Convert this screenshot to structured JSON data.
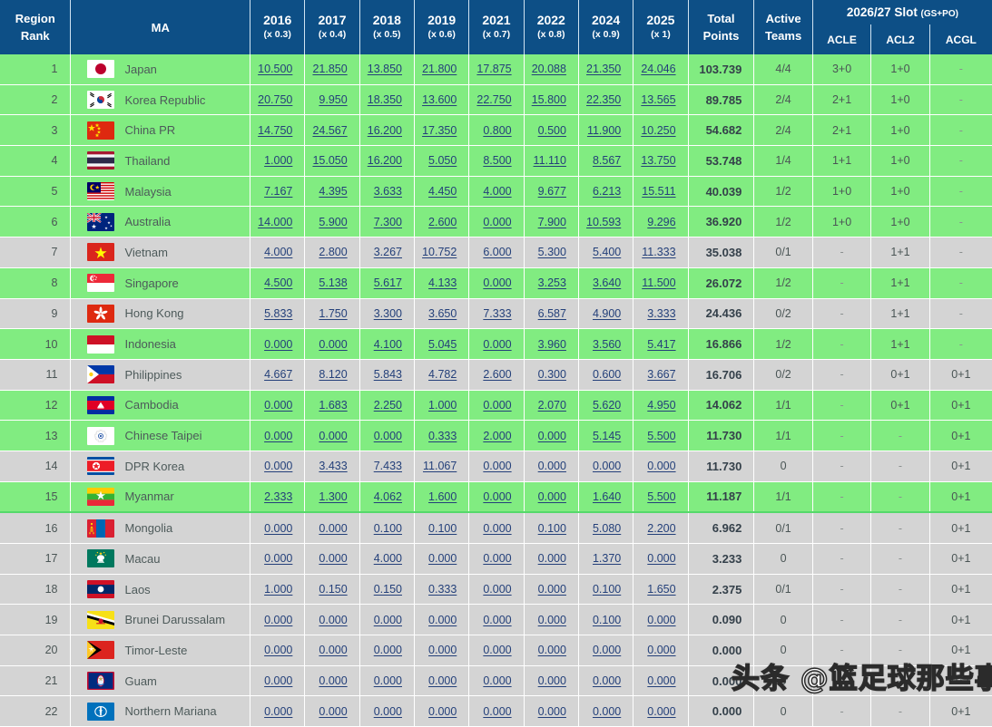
{
  "header": {
    "region_rank": "Region\nRank",
    "region_rank_l1": "Region",
    "region_rank_l2": "Rank",
    "ma": "MA",
    "years": [
      {
        "year": "2016",
        "mult": "(x 0.3)"
      },
      {
        "year": "2017",
        "mult": "(x 0.4)"
      },
      {
        "year": "2018",
        "mult": "(x 0.5)"
      },
      {
        "year": "2019",
        "mult": "(x 0.6)"
      },
      {
        "year": "2021",
        "mult": "(x 0.7)"
      },
      {
        "year": "2022",
        "mult": "(x 0.8)"
      },
      {
        "year": "2024",
        "mult": "(x 0.9)"
      },
      {
        "year": "2025",
        "mult": "(x 1)"
      }
    ],
    "total_points_l1": "Total",
    "total_points_l2": "Points",
    "active_teams_l1": "Active",
    "active_teams_l2": "Teams",
    "slot_group_title": "2026/27 Slot",
    "slot_group_sub": "(GS+PO)",
    "slot_cols": [
      "ACLE",
      "ACL2",
      "ACGL"
    ]
  },
  "colors": {
    "header_blue": "#0d4f86",
    "row_green": "#81ec81",
    "row_grey": "#d4d4d4",
    "number_blue": "#24407a",
    "separator_green": "#55d96a"
  },
  "watermark": "头条 @篮足球那些事",
  "rows": [
    {
      "rank": "1",
      "ma": "Japan",
      "flag": "japan",
      "shade": "green",
      "sep": false,
      "years": [
        "10.500",
        "21.850",
        "13.850",
        "21.800",
        "17.875",
        "20.088",
        "21.350",
        "24.046"
      ],
      "total": "103.739",
      "active": "4/4",
      "acle": "3+0",
      "acl2": "1+0",
      "acgl": "-"
    },
    {
      "rank": "2",
      "ma": "Korea Republic",
      "flag": "korea",
      "shade": "green",
      "sep": false,
      "years": [
        "20.750",
        "9.950",
        "18.350",
        "13.600",
        "22.750",
        "15.800",
        "22.350",
        "13.565"
      ],
      "total": "89.785",
      "active": "2/4",
      "acle": "2+1",
      "acl2": "1+0",
      "acgl": "-"
    },
    {
      "rank": "3",
      "ma": "China PR",
      "flag": "china",
      "shade": "green",
      "sep": false,
      "years": [
        "14.750",
        "24.567",
        "16.200",
        "17.350",
        "0.800",
        "0.500",
        "11.900",
        "10.250"
      ],
      "total": "54.682",
      "active": "2/4",
      "acle": "2+1",
      "acl2": "1+0",
      "acgl": "-"
    },
    {
      "rank": "4",
      "ma": "Thailand",
      "flag": "thailand",
      "shade": "green",
      "sep": false,
      "years": [
        "1.000",
        "15.050",
        "16.200",
        "5.050",
        "8.500",
        "11.110",
        "8.567",
        "13.750"
      ],
      "total": "53.748",
      "active": "1/4",
      "acle": "1+1",
      "acl2": "1+0",
      "acgl": "-"
    },
    {
      "rank": "5",
      "ma": "Malaysia",
      "flag": "malaysia",
      "shade": "green",
      "sep": false,
      "years": [
        "7.167",
        "4.395",
        "3.633",
        "4.450",
        "4.000",
        "9.677",
        "6.213",
        "15.511"
      ],
      "total": "40.039",
      "active": "1/2",
      "acle": "1+0",
      "acl2": "1+0",
      "acgl": "-"
    },
    {
      "rank": "6",
      "ma": "Australia",
      "flag": "australia",
      "shade": "green",
      "sep": false,
      "years": [
        "14.000",
        "5.900",
        "7.300",
        "2.600",
        "0.000",
        "7.900",
        "10.593",
        "9.296"
      ],
      "total": "36.920",
      "active": "1/2",
      "acle": "1+0",
      "acl2": "1+0",
      "acgl": "-"
    },
    {
      "rank": "7",
      "ma": "Vietnam",
      "flag": "vietnam",
      "shade": "grey",
      "sep": false,
      "years": [
        "4.000",
        "2.800",
        "3.267",
        "10.752",
        "6.000",
        "5.300",
        "5.400",
        "11.333"
      ],
      "total": "35.038",
      "active": "0/1",
      "acle": "-",
      "acl2": "1+1",
      "acgl": "-"
    },
    {
      "rank": "8",
      "ma": "Singapore",
      "flag": "singapore",
      "shade": "green",
      "sep": false,
      "years": [
        "4.500",
        "5.138",
        "5.617",
        "4.133",
        "0.000",
        "3.253",
        "3.640",
        "11.500"
      ],
      "total": "26.072",
      "active": "1/2",
      "acle": "-",
      "acl2": "1+1",
      "acgl": "-"
    },
    {
      "rank": "9",
      "ma": "Hong Kong",
      "flag": "hongkong",
      "shade": "grey",
      "sep": false,
      "years": [
        "5.833",
        "1.750",
        "3.300",
        "3.650",
        "7.333",
        "6.587",
        "4.900",
        "3.333"
      ],
      "total": "24.436",
      "active": "0/2",
      "acle": "-",
      "acl2": "1+1",
      "acgl": "-"
    },
    {
      "rank": "10",
      "ma": "Indonesia",
      "flag": "indonesia",
      "shade": "green",
      "sep": false,
      "years": [
        "0.000",
        "0.000",
        "4.100",
        "5.045",
        "0.000",
        "3.960",
        "3.560",
        "5.417"
      ],
      "total": "16.866",
      "active": "1/2",
      "acle": "-",
      "acl2": "1+1",
      "acgl": "-"
    },
    {
      "rank": "11",
      "ma": "Philippines",
      "flag": "philippines",
      "shade": "grey",
      "sep": false,
      "years": [
        "4.667",
        "8.120",
        "5.843",
        "4.782",
        "2.600",
        "0.300",
        "0.600",
        "3.667"
      ],
      "total": "16.706",
      "active": "0/2",
      "acle": "-",
      "acl2": "0+1",
      "acgl": "0+1"
    },
    {
      "rank": "12",
      "ma": "Cambodia",
      "flag": "cambodia",
      "shade": "green",
      "sep": false,
      "years": [
        "0.000",
        "1.683",
        "2.250",
        "1.000",
        "0.000",
        "2.070",
        "5.620",
        "4.950"
      ],
      "total": "14.062",
      "active": "1/1",
      "acle": "-",
      "acl2": "0+1",
      "acgl": "0+1"
    },
    {
      "rank": "13",
      "ma": "Chinese Taipei",
      "flag": "taipei",
      "shade": "green",
      "sep": false,
      "years": [
        "0.000",
        "0.000",
        "0.000",
        "0.333",
        "2.000",
        "0.000",
        "5.145",
        "5.500"
      ],
      "total": "11.730",
      "active": "1/1",
      "acle": "-",
      "acl2": "-",
      "acgl": "0+1"
    },
    {
      "rank": "14",
      "ma": "DPR Korea",
      "flag": "dprkorea",
      "shade": "grey",
      "sep": false,
      "years": [
        "0.000",
        "3.433",
        "7.433",
        "11.067",
        "0.000",
        "0.000",
        "0.000",
        "0.000"
      ],
      "total": "11.730",
      "active": "0",
      "acle": "-",
      "acl2": "-",
      "acgl": "0+1"
    },
    {
      "rank": "15",
      "ma": "Myanmar",
      "flag": "myanmar",
      "shade": "green",
      "sep": false,
      "years": [
        "2.333",
        "1.300",
        "4.062",
        "1.600",
        "0.000",
        "0.000",
        "1.640",
        "5.500"
      ],
      "total": "11.187",
      "active": "1/1",
      "acle": "-",
      "acl2": "-",
      "acgl": "0+1"
    },
    {
      "rank": "16",
      "ma": "Mongolia",
      "flag": "mongolia",
      "shade": "grey",
      "sep": true,
      "years": [
        "0.000",
        "0.000",
        "0.100",
        "0.100",
        "0.000",
        "0.100",
        "5.080",
        "2.200"
      ],
      "total": "6.962",
      "active": "0/1",
      "acle": "-",
      "acl2": "-",
      "acgl": "0+1"
    },
    {
      "rank": "17",
      "ma": "Macau",
      "flag": "macau",
      "shade": "grey",
      "sep": false,
      "years": [
        "0.000",
        "0.000",
        "4.000",
        "0.000",
        "0.000",
        "0.000",
        "1.370",
        "0.000"
      ],
      "total": "3.233",
      "active": "0",
      "acle": "-",
      "acl2": "-",
      "acgl": "0+1"
    },
    {
      "rank": "18",
      "ma": "Laos",
      "flag": "laos",
      "shade": "grey",
      "sep": false,
      "years": [
        "1.000",
        "0.150",
        "0.150",
        "0.333",
        "0.000",
        "0.000",
        "0.100",
        "1.650"
      ],
      "total": "2.375",
      "active": "0/1",
      "acle": "-",
      "acl2": "-",
      "acgl": "0+1"
    },
    {
      "rank": "19",
      "ma": "Brunei Darussalam",
      "flag": "brunei",
      "shade": "grey",
      "sep": false,
      "years": [
        "0.000",
        "0.000",
        "0.000",
        "0.000",
        "0.000",
        "0.000",
        "0.100",
        "0.000"
      ],
      "total": "0.090",
      "active": "0",
      "acle": "-",
      "acl2": "-",
      "acgl": "0+1"
    },
    {
      "rank": "20",
      "ma": "Timor-Leste",
      "flag": "timor",
      "shade": "grey",
      "sep": false,
      "years": [
        "0.000",
        "0.000",
        "0.000",
        "0.000",
        "0.000",
        "0.000",
        "0.000",
        "0.000"
      ],
      "total": "0.000",
      "active": "0",
      "acle": "-",
      "acl2": "-",
      "acgl": "0+1"
    },
    {
      "rank": "21",
      "ma": "Guam",
      "flag": "guam",
      "shade": "grey",
      "sep": false,
      "years": [
        "0.000",
        "0.000",
        "0.000",
        "0.000",
        "0.000",
        "0.000",
        "0.000",
        "0.000"
      ],
      "total": "0.000",
      "active": "0",
      "acle": "-",
      "acl2": "-",
      "acgl": "0+1"
    },
    {
      "rank": "22",
      "ma": "Northern Mariana",
      "flag": "mariana",
      "shade": "grey",
      "sep": false,
      "years": [
        "0.000",
        "0.000",
        "0.000",
        "0.000",
        "0.000",
        "0.000",
        "0.000",
        "0.000"
      ],
      "total": "0.000",
      "active": "0",
      "acle": "-",
      "acl2": "-",
      "acgl": "0+1"
    }
  ]
}
